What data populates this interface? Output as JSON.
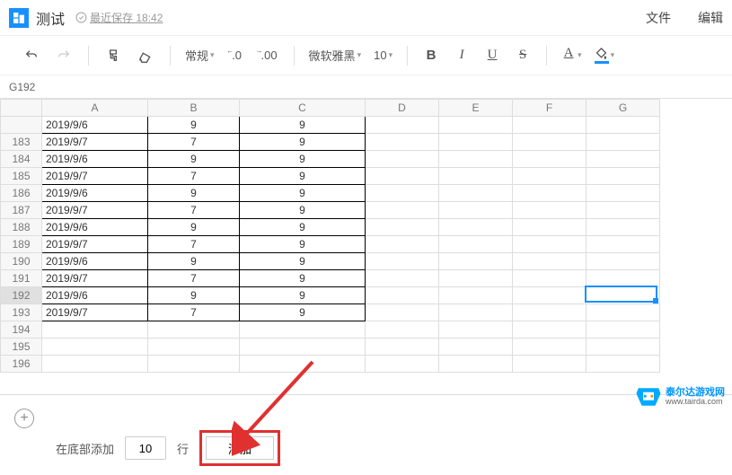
{
  "header": {
    "title": "测试",
    "save_status": "最近保存 18:42",
    "menu": {
      "file": "文件",
      "edit": "编辑"
    }
  },
  "toolbar": {
    "format_label": "常规",
    "decimals_less": ".0",
    "decimals_more": ".00",
    "font_name": "微软雅黑",
    "font_size": "10",
    "bold": "B",
    "italic": "I",
    "underline": "U",
    "strike": "S",
    "text_color_letter": "A",
    "text_color_underline": "#000000",
    "fill_color_underline": "#1890ff"
  },
  "cell_ref": "G192",
  "columns": [
    "A",
    "B",
    "C",
    "D",
    "E",
    "F",
    "G"
  ],
  "column_widths": {
    "A": "col-A",
    "B": "col-B",
    "C": "col-C",
    "D": "col-oth",
    "E": "col-oth",
    "F": "col-oth",
    "G": "col-oth"
  },
  "first_row_partial": {
    "num": "",
    "A": "2019/9/6",
    "B": "9",
    "C": "9"
  },
  "rows": [
    {
      "num": 183,
      "A": "2019/9/7",
      "B": "7",
      "C": "9"
    },
    {
      "num": 184,
      "A": "2019/9/6",
      "B": "9",
      "C": "9"
    },
    {
      "num": 185,
      "A": "2019/9/7",
      "B": "7",
      "C": "9"
    },
    {
      "num": 186,
      "A": "2019/9/6",
      "B": "9",
      "C": "9"
    },
    {
      "num": 187,
      "A": "2019/9/7",
      "B": "7",
      "C": "9"
    },
    {
      "num": 188,
      "A": "2019/9/6",
      "B": "9",
      "C": "9"
    },
    {
      "num": 189,
      "A": "2019/9/7",
      "B": "7",
      "C": "9"
    },
    {
      "num": 190,
      "A": "2019/9/6",
      "B": "9",
      "C": "9"
    },
    {
      "num": 191,
      "A": "2019/9/7",
      "B": "7",
      "C": "9"
    },
    {
      "num": 192,
      "A": "2019/9/6",
      "B": "9",
      "C": "9"
    },
    {
      "num": 193,
      "A": "2019/9/7",
      "B": "7",
      "C": "9"
    },
    {
      "num": 194,
      "A": "",
      "B": "",
      "C": ""
    },
    {
      "num": 195,
      "A": "",
      "B": "",
      "C": ""
    },
    {
      "num": 196,
      "A": "",
      "B": "",
      "C": ""
    }
  ],
  "data_last_row": 193,
  "selected_row": 192,
  "footer": {
    "add_prefix": "在底部添加",
    "row_count": "10",
    "add_suffix": "行",
    "add_button": "添加"
  },
  "watermark": {
    "line1": "泰尔达游戏网",
    "line2": "www.tairda.com"
  }
}
